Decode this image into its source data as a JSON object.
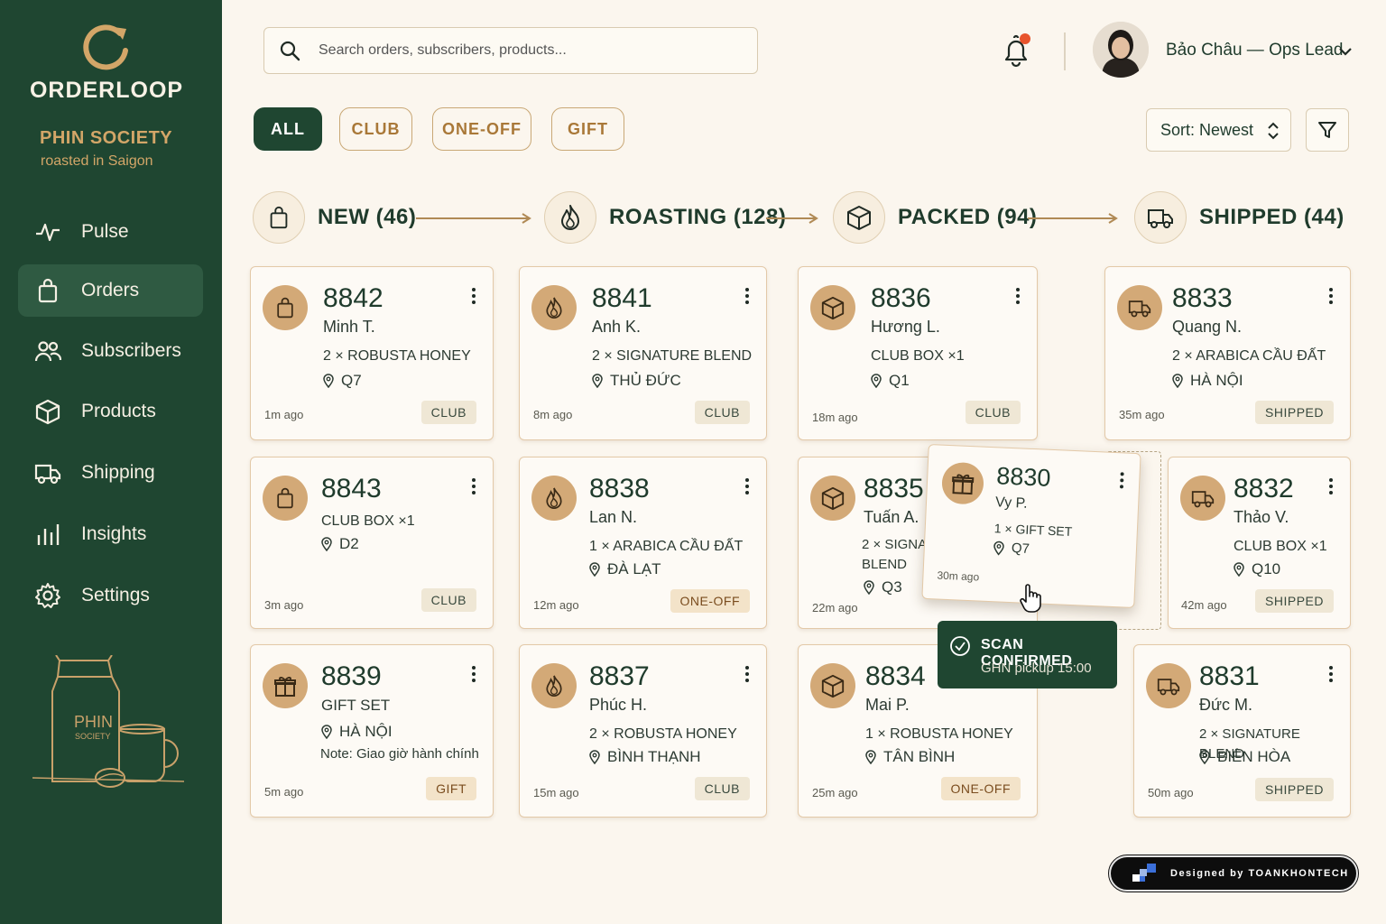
{
  "app": {
    "brand": "ORDERLOOP",
    "shop_name": "PHIN SOCIETY",
    "shop_tagline": "roasted in Saigon",
    "illustration_label": "PHIN",
    "illustration_sub": "SOCIETY"
  },
  "sidebar": {
    "items": [
      {
        "label": "Pulse",
        "icon": "pulse-icon"
      },
      {
        "label": "Orders",
        "icon": "bag-icon",
        "active": true
      },
      {
        "label": "Subscribers",
        "icon": "users-icon"
      },
      {
        "label": "Products",
        "icon": "box-icon"
      },
      {
        "label": "Shipping",
        "icon": "truck-icon"
      },
      {
        "label": "Insights",
        "icon": "bar-chart-icon"
      },
      {
        "label": "Settings",
        "icon": "gear-icon"
      }
    ]
  },
  "header": {
    "search_placeholder": "Search orders, subscribers, products...",
    "user_name": "Bảo Châu — Ops Lead",
    "notification_dot": "#e8542c"
  },
  "filters": [
    {
      "label": "ALL",
      "active": true
    },
    {
      "label": "CLUB"
    },
    {
      "label": "ONE-OFF"
    },
    {
      "label": "GIFT"
    }
  ],
  "sort": {
    "label": "Sort: Newest"
  },
  "stages": [
    {
      "label": "NEW (46)",
      "icon": "bag-icon"
    },
    {
      "label": "ROASTING (128)",
      "icon": "flame-icon"
    },
    {
      "label": "PACKED (94)",
      "icon": "box-icon"
    },
    {
      "label": "SHIPPED (44)",
      "icon": "truck-icon"
    }
  ],
  "cards": {
    "c8842": {
      "num": "8842",
      "name": "Minh T.",
      "item": "2 × ROBUSTA HONEY",
      "loc": "Q7",
      "time": "1m ago",
      "tag": "CLUB"
    },
    "c8841": {
      "num": "8841",
      "name": "Anh K.",
      "item": "2 × SIGNATURE BLEND",
      "loc": "THỦ ĐỨC",
      "time": "8m ago",
      "tag": "CLUB"
    },
    "c8836": {
      "num": "8836",
      "name": "Hương L.",
      "item": "CLUB BOX ×1",
      "loc": "Q1",
      "time": "18m ago",
      "tag": "CLUB"
    },
    "c8833": {
      "num": "8833",
      "name": "Quang N.",
      "item": "2 × ARABICA CẦU ĐẤT",
      "loc": "HÀ NỘI",
      "time": "35m ago",
      "tag": "SHIPPED"
    },
    "c8843": {
      "num": "8843",
      "item": "CLUB BOX ×1",
      "loc": "D2",
      "time": "3m ago",
      "tag": "CLUB"
    },
    "c8838": {
      "num": "8838",
      "name": "Lan N.",
      "item": "1 × ARABICA CẦU ĐẤT",
      "loc": "ĐÀ LẠT",
      "time": "12m ago",
      "tag": "ONE-OFF"
    },
    "c8835": {
      "num": "8835",
      "name": "Tuấn A.",
      "item": "2 × SIGNAT",
      "item2": "BLEND",
      "loc": "Q3",
      "time": "22m ago"
    },
    "c8830": {
      "num": "8830",
      "name": "Vy P.",
      "item": "1 × GIFT SET",
      "loc": "Q7",
      "time": "30m ago"
    },
    "c8832": {
      "num": "8832",
      "name": "Thảo V.",
      "item": "CLUB BOX ×1",
      "loc": "Q10",
      "time": "42m ago",
      "tag": "SHIPPED"
    },
    "c8839": {
      "num": "8839",
      "name": "GIFT SET",
      "loc": "HÀ NỘI",
      "note": "Note: Giao giờ hành chính",
      "time": "5m ago",
      "tag": "GIFT"
    },
    "c8837": {
      "num": "8837",
      "name": "Phúc H.",
      "item": "2 × ROBUSTA HONEY",
      "loc": "BÌNH THẠNH",
      "time": "15m ago",
      "tag": "CLUB"
    },
    "c8834": {
      "num": "8834",
      "name": "Mai P.",
      "item": "1 × ROBUSTA HONEY",
      "loc": "TÂN BÌNH",
      "time": "25m ago",
      "tag": "ONE-OFF"
    },
    "c8831": {
      "num": "8831",
      "name": "Đức M.",
      "item": "2 × SIGNATURE BLEND",
      "loc": "BIÊN HÒA",
      "time": "50m ago",
      "tag": "SHIPPED"
    }
  },
  "toast": {
    "title": "SCAN CONFIRMED",
    "detail": "GHN pickup 15:00"
  },
  "credit": {
    "text": "Designed by TOANKHONTECH"
  },
  "colors": {
    "sidebar": "#1f4631",
    "accent": "#c9a876",
    "background": "#fbf6ee"
  }
}
